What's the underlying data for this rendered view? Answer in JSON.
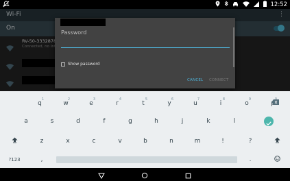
{
  "status_bar": {
    "time": "12:52",
    "icons": [
      "notifications-off-icon",
      "location-icon",
      "bluetooth-icon",
      "car-icon",
      "wifi-icon",
      "signal-icon",
      "battery-icon"
    ]
  },
  "app_bar": {
    "title": "Wi-Fi",
    "menu_glyph": "⋮"
  },
  "wifi_toggle": {
    "label": "On",
    "state": "on",
    "accent": "#4fb6d1"
  },
  "networks": [
    {
      "name": "RV-50-3332878",
      "status": "Connected, no Internet"
    },
    {
      "name": "",
      "status": ""
    },
    {
      "name": "",
      "status": ""
    }
  ],
  "dialog": {
    "field_label": "Password",
    "password_value": "",
    "show_password_label": "Show password",
    "cancel_label": "CANCEL",
    "connect_label": "CONNECT",
    "accent": "#4fb3d9"
  },
  "keyboard": {
    "row1": [
      {
        "key": "q",
        "hint": "1"
      },
      {
        "key": "w",
        "hint": "2"
      },
      {
        "key": "e",
        "hint": "3"
      },
      {
        "key": "r",
        "hint": "4"
      },
      {
        "key": "t",
        "hint": "5"
      },
      {
        "key": "y",
        "hint": "6"
      },
      {
        "key": "u",
        "hint": "7"
      },
      {
        "key": "i",
        "hint": "8"
      },
      {
        "key": "o",
        "hint": "9"
      },
      {
        "key": "p",
        "hint": "0"
      }
    ],
    "row2": [
      "a",
      "s",
      "d",
      "f",
      "g",
      "h",
      "j",
      "k",
      "l"
    ],
    "row3": [
      "z",
      "x",
      "c",
      "v",
      "b",
      "n",
      "m",
      "!",
      "?"
    ],
    "symbols_label": "?123",
    "comma": ",",
    "period": ".",
    "enter_color": "#4db6ac"
  },
  "nav_bar": {
    "buttons": [
      "back",
      "home",
      "recents"
    ]
  }
}
